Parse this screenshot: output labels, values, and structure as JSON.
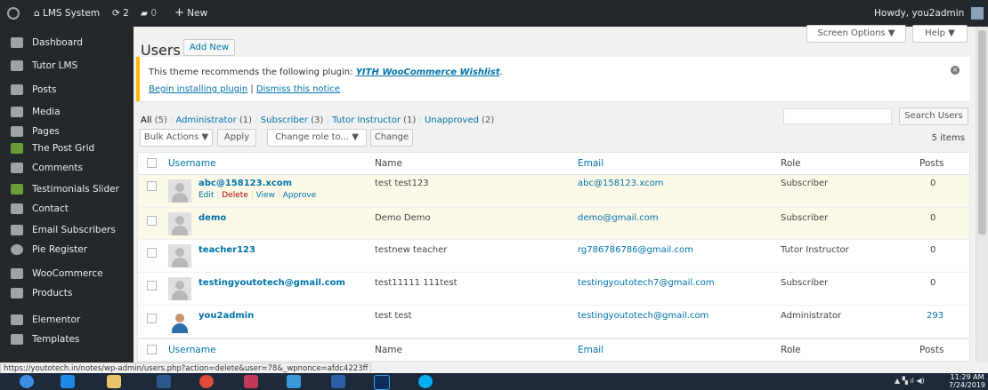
{
  "adminbar": {
    "site_name": "LMS System",
    "updates_count": "2",
    "comments_count": "0",
    "new_label": "New",
    "howdy": "Howdy, you2admin"
  },
  "sidebar": {
    "items": [
      {
        "label": "Dashboard",
        "icon": "dashboard-icon"
      },
      {
        "label": "Tutor LMS",
        "icon": "tutor-icon"
      },
      {
        "label": "Posts",
        "icon": "pin-icon"
      },
      {
        "label": "Media",
        "icon": "media-icon"
      },
      {
        "label": "Pages",
        "icon": "pages-icon"
      },
      {
        "label": "The Post Grid",
        "icon": "grid-icon"
      },
      {
        "label": "Comments",
        "icon": "comment-icon"
      },
      {
        "label": "Testimonials Slider",
        "icon": "slider-icon"
      },
      {
        "label": "Contact",
        "icon": "mail-icon"
      },
      {
        "label": "Email Subscribers",
        "icon": "mail-icon"
      },
      {
        "label": "Pie Register",
        "icon": "pie-icon"
      },
      {
        "label": "WooCommerce",
        "icon": "woo-icon"
      },
      {
        "label": "Products",
        "icon": "box-icon"
      },
      {
        "label": "Elementor",
        "icon": "elementor-icon"
      },
      {
        "label": "Templates",
        "icon": "folder-icon"
      }
    ]
  },
  "header": {
    "title": "Users",
    "add_new": "Add New",
    "screen_options": "Screen Options ▼",
    "help": "Help ▼"
  },
  "notice": {
    "text": "This theme recommends the following plugin:",
    "plugin": "YITH WooCommerce Wishlist",
    "period": ".",
    "install": "Begin installing plugin",
    "sep": "|",
    "dismiss": "Dismiss this notice"
  },
  "filters": {
    "all": "All",
    "all_count": "(5)",
    "administrator": "Administrator",
    "administrator_count": "(1)",
    "subscriber": "Subscriber",
    "subscriber_count": "(3)",
    "tutor_instructor": "Tutor Instructor",
    "tutor_instructor_count": "(1)",
    "unapproved": "Unapproved",
    "unapproved_count": "(2)",
    "sep": "|"
  },
  "search": {
    "value": "",
    "button": "Search Users"
  },
  "actions": {
    "bulk": "Bulk Actions ▼",
    "apply": "Apply",
    "role": "Change role to... ▼",
    "change": "Change",
    "items_count": "5 items"
  },
  "table": {
    "headers": {
      "username": "Username",
      "name": "Name",
      "email": "Email",
      "role": "Role",
      "posts": "Posts"
    },
    "row_actions": {
      "edit": "Edit",
      "delete": "Delete",
      "view": "View",
      "approve": "Approve",
      "sep": "|"
    },
    "rows": [
      {
        "username": "abc@158123.xcom",
        "name": "test test123",
        "email": "abc@158123.xcom",
        "role": "Subscriber",
        "posts": "0"
      },
      {
        "username": "demo",
        "name": "Demo Demo",
        "email": "demo@gmail.com",
        "role": "Subscriber",
        "posts": "0"
      },
      {
        "username": "teacher123",
        "name": "testnew teacher",
        "email": "rg786786786@gmail.com",
        "role": "Tutor Instructor",
        "posts": "0"
      },
      {
        "username": "testingyoutotech@gmail.com",
        "name": "test11111 111test",
        "email": "testingyoutotech7@gmail.com",
        "role": "Subscriber",
        "posts": "0"
      },
      {
        "username": "you2admin",
        "name": "test test",
        "email": "testingyoutotech@gmail.com",
        "role": "Administrator",
        "posts": "293"
      }
    ]
  },
  "status_url": "https://youtotech.in/notes/wp-admin/users.php?action=delete&user=78&_wpnonce=afdc4223ff",
  "clock": {
    "time": "11:29 AM",
    "date": "7/24/2019"
  }
}
